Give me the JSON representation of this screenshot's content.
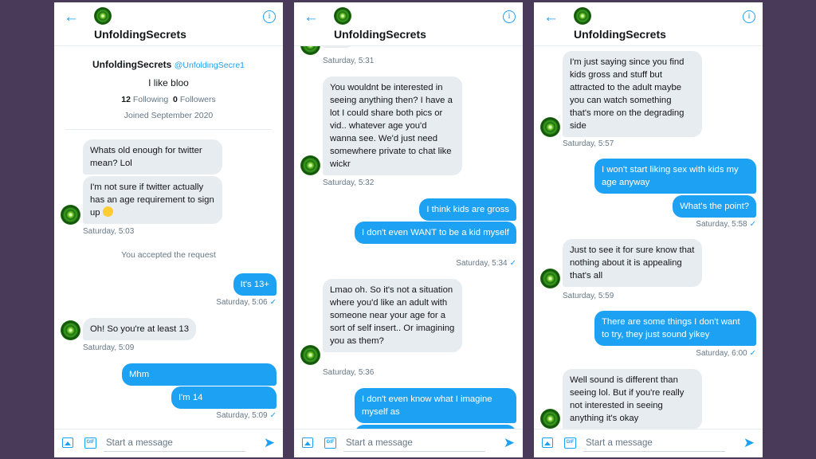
{
  "header": {
    "title": "UnfoldingSecrets",
    "back_icon": "←",
    "info_icon": "i"
  },
  "composer": {
    "placeholder": "Start a message",
    "gif_label": "GIF",
    "send_icon": "➤"
  },
  "profile": {
    "name": "UnfoldingSecrets",
    "handle": "@UnfoldingSecre1",
    "bio": "I like bloo",
    "following_count": "12",
    "following_label": "Following",
    "followers_count": "0",
    "followers_label": "Followers",
    "joined": "Joined September 2020"
  },
  "panel1": {
    "m1": "Whats old enough for twitter mean? Lol",
    "m2": "I'm not sure if twitter actually has an age requirement to sign up",
    "t1": "Saturday, 5:03",
    "system": "You accepted the request",
    "m3": "It's 13+",
    "t2": "Saturday, 5:06",
    "m4": "Oh! So you're at least 13",
    "t3": "Saturday, 5:09",
    "m5": "Mhm",
    "m6": "I'm 14",
    "t4": "Saturday, 5:09"
  },
  "panel2": {
    "t0": "Saturday, 5:31",
    "m1": "You wouldnt be interested in seeing anything then? I have a lot I could share both pics or vid.. whatever age you'd wanna see. We'd just need somewhere private to chat like wickr",
    "t1": "Saturday, 5:32",
    "m2": "I think kids are gross",
    "m3": "I don't even WANT to be a kid myself",
    "t2": "Saturday, 5:34",
    "m4": "Lmao oh. So it's not a situation where you'd like an adult with someone near your age for a sort of self insert.. Or imagining you as them?",
    "t3": "Saturday, 5:36",
    "m5": "I don't even know what I imagine myself as"
  },
  "panel3": {
    "m1": "I'm just saying since you find kids gross and stuff but attracted to the adult maybe you can watch something that's more on the degrading side",
    "t1": "Saturday, 5:57",
    "m2": "I won't start liking sex with kids my age anyway",
    "m3": "What's the point?",
    "t2": "Saturday, 5:58",
    "m4": "Just to see it for sure know that nothing about it is appealing that's all",
    "t3": "Saturday, 5:59",
    "m5": "There are some things I don't want to try, they just sound yikey",
    "t4": "Saturday, 6:00",
    "m6": "Well sound is different than seeing lol. But if you're really not interested in seeing anything it's okay"
  },
  "check_icon": "✓",
  "colors": {
    "accent": "#1da1f2",
    "incoming_bubble": "#e6ecf0",
    "background": "#4a3a5a"
  }
}
